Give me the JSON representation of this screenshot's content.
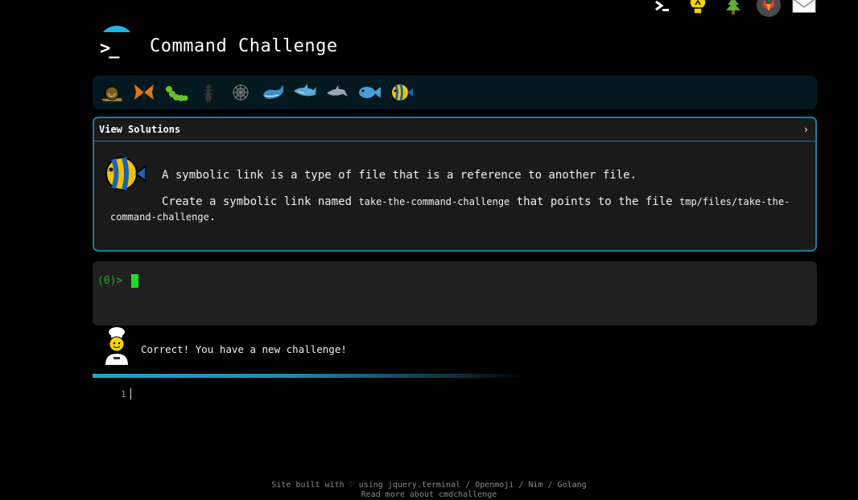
{
  "header": {
    "title": "Command Challenge",
    "logo_prompt": ">_"
  },
  "top_icons": [
    "terminal-icon",
    "lightbulb-icon",
    "tree-icon",
    "gitlab-fox-icon",
    "envelope-icon"
  ],
  "levels": [
    "snail-icon",
    "butterfly-icon",
    "caterpillar-icon",
    "ant-icon",
    "web-icon",
    "whale-icon",
    "shark-icon",
    "dolphin-icon",
    "fish-icon",
    "tropical-fish-icon"
  ],
  "challenge": {
    "solutions_label": "View Solutions",
    "chevron": "›",
    "intro": "A symbolic link is a type of file that is a reference to another file.",
    "task_pre": "Create a symbolic link named ",
    "link_name": "take-the-command-challenge",
    "task_mid": " that points to the file ",
    "target_path": "tmp/files/take-the-command-challenge",
    "task_post": "."
  },
  "terminal": {
    "prompt": "(0)>"
  },
  "message": {
    "text": "Correct! You have a new challenge!"
  },
  "editor": {
    "line_number": "1"
  },
  "footer": {
    "line1": "Site built with ♡ using jquery.terminal / Openmoji / Nim / Golang",
    "line2": "Read more about cmdchallenge"
  },
  "colors": {
    "accent": "#1bb6e8",
    "border": "#1f7a96",
    "prompt_green": "#2aa92a",
    "cursor_green": "#19e019"
  }
}
